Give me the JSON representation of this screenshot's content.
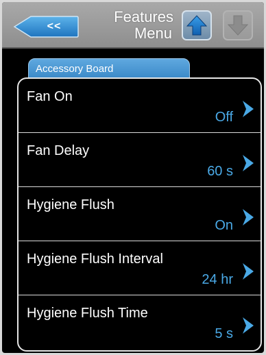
{
  "header": {
    "back_label": "<<",
    "title_line1": "Features",
    "title_line2": "Menu",
    "up_icon": "arrow-up-icon",
    "down_icon": "arrow-down-icon",
    "back_icon": "back-arrow-icon"
  },
  "tab": {
    "label": "Accessory Board"
  },
  "items": [
    {
      "label": "Fan On",
      "value": "Off"
    },
    {
      "label": "Fan Delay",
      "value": "60 s"
    },
    {
      "label": "Hygiene Flush",
      "value": "On"
    },
    {
      "label": "Hygiene Flush Interval",
      "value": "24 hr"
    },
    {
      "label": "Hygiene Flush Time",
      "value": "5 s"
    }
  ],
  "colors": {
    "accent_blue": "#2f7fc0",
    "value_blue": "#4aa9e6",
    "header_gray": "#9a9a9a",
    "background": "#000000"
  }
}
